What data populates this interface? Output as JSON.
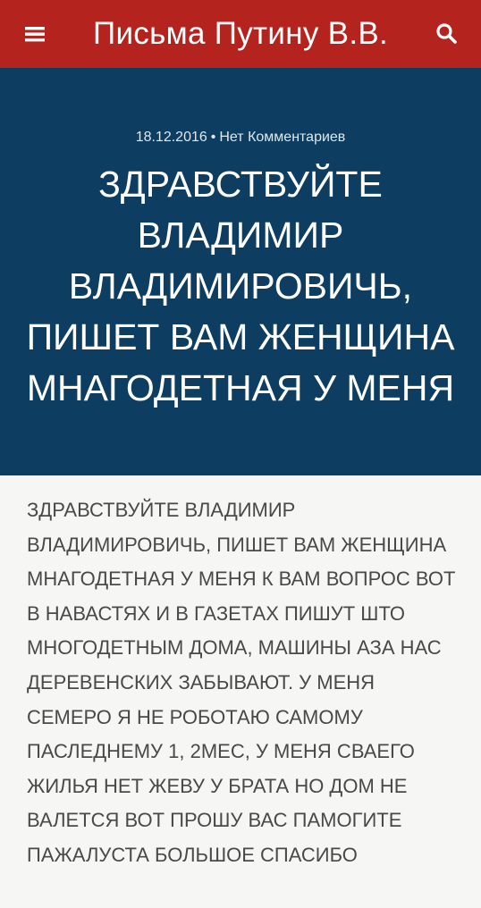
{
  "header": {
    "title": "Письма Путину В.В.",
    "menu_icon": "hamburger-menu-icon",
    "search_icon": "search-icon",
    "background_color": "#b5231f"
  },
  "post": {
    "date": "18.12.2016",
    "separator": "•",
    "comments": "Нет Комментариев",
    "title": "ЗДРАВСТВУЙТЕ ВЛАДИМИР ВЛАДИМИРОВИЧЬ, ПИШЕТ ВАМ ЖЕНЩИНА МНАГОДЕТНАЯ У МЕНЯ",
    "hero_color": "#0d3d61",
    "body": "ЗДРАВСТВУЙТЕ ВЛАДИМИР ВЛАДИМИРОВИЧЬ, ПИШЕТ ВАМ ЖЕНЩИНА МНАГОДЕТНАЯ У МЕНЯ К ВАМ ВОПРОС ВОТ В НАВАСТЯХ И В ГАЗЕТАХ ПИШУТ ШТО МНОГОДЕТНЫМ ДОМА, МАШИНЫ АЗА НАС ДЕРЕВЕНСКИХ ЗАБЫВАЮТ. У МЕНЯ СЕМЕРО Я НЕ РОБОТАЮ САМОМУ ПАСЛЕДНЕМУ 1, 2МЕС, У МЕНЯ СВАЕГО ЖИЛЬЯ НЕТ ЖЕВУ У БРАТА НО ДОМ НЕ ВАЛЕТСЯ ВОТ ПРОШУ ВАС ПАМОГИТЕ ПАЖАЛУСТА БОЛЬШОЕ СПАСИБО"
  }
}
